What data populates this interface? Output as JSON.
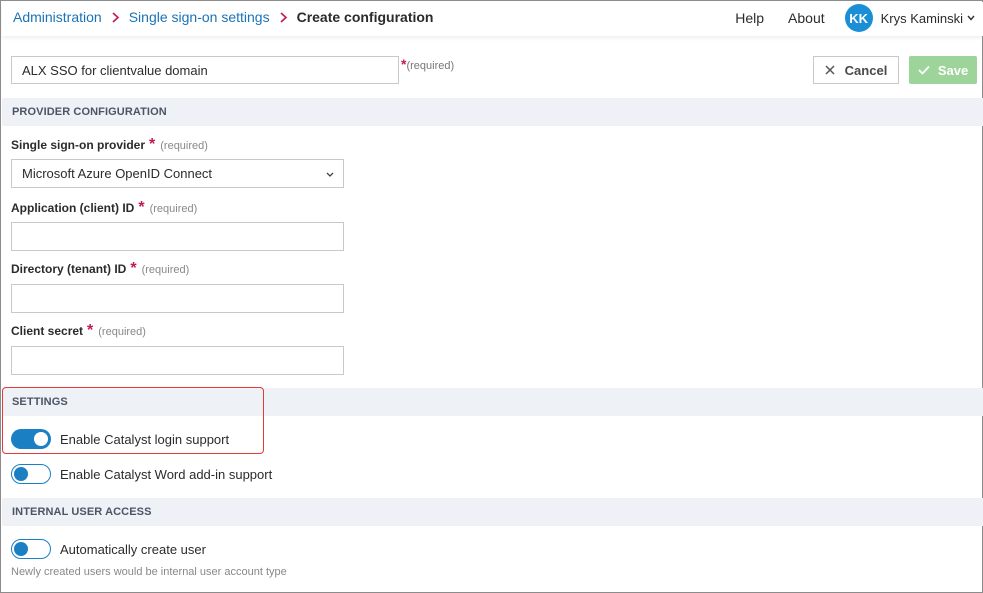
{
  "breadcrumb": {
    "items": [
      "Administration",
      "Single sign-on settings"
    ],
    "current": "Create configuration"
  },
  "topnav": {
    "help": "Help",
    "about": "About",
    "user_initials": "KK",
    "user_name": "Krys Kaminski"
  },
  "config_name": {
    "value": "ALX SSO for clientvalue domain",
    "required_star": "*",
    "required_label": "(required)"
  },
  "actions": {
    "cancel_label": "Cancel",
    "save_label": "Save"
  },
  "sections": {
    "provider": "PROVIDER CONFIGURATION",
    "settings": "SETTINGS",
    "internal": "INTERNAL USER ACCESS"
  },
  "fields": {
    "required_star": "*",
    "required_label": "(required)",
    "provider_label": "Single sign-on provider",
    "provider_value": "Microsoft Azure OpenID Connect",
    "client_id_label": "Application (client) ID",
    "client_id_value": "",
    "tenant_id_label": "Directory (tenant) ID",
    "tenant_id_value": "",
    "secret_label": "Client secret",
    "secret_value": ""
  },
  "toggles": {
    "login_support": {
      "label": "Enable Catalyst login support",
      "state": "on"
    },
    "word_addin": {
      "label": "Enable Catalyst Word add-in support",
      "state": "off"
    },
    "auto_create": {
      "label": "Automatically create user",
      "state": "off"
    }
  },
  "helper": {
    "auto_create": "Newly created users would be internal user account type"
  },
  "colors": {
    "link": "#1a73b8",
    "accent": "#1b7fc4",
    "required": "#c2185b",
    "save_disabled": "#9cd49a",
    "highlight": "#e53935",
    "section_bg": "#eef1f5"
  }
}
